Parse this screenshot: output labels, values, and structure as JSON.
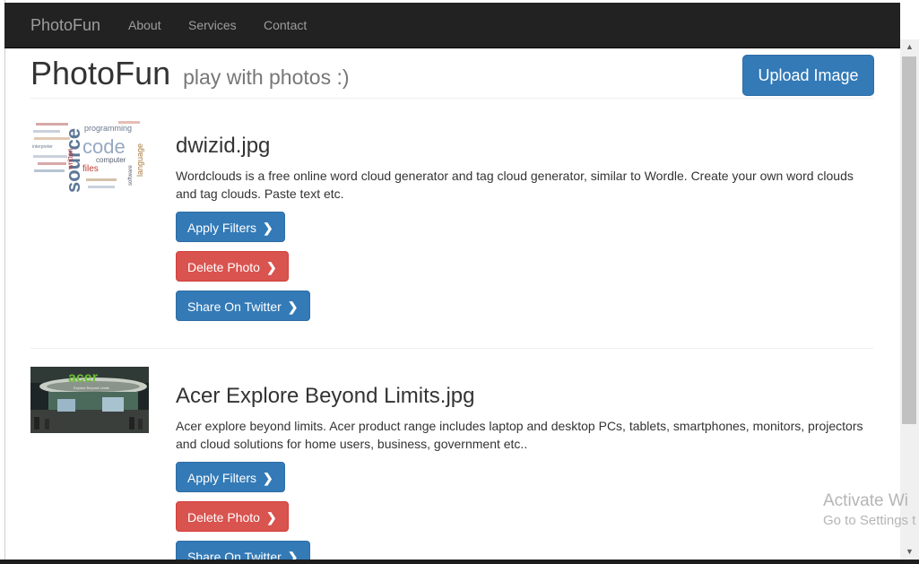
{
  "navbar": {
    "brand": "PhotoFun",
    "links": [
      "About",
      "Services",
      "Contact"
    ]
  },
  "header": {
    "title": "PhotoFun",
    "subtitle": "play with photos :)",
    "upload_label": "Upload Image"
  },
  "photos": [
    {
      "name": "dwizid.jpg",
      "description": "Wordclouds is a free online word cloud generator and tag cloud generator, similar to Wordle. Create your own word clouds and tag clouds. Paste text etc.",
      "thumbnail_words": [
        "programming",
        "source",
        "code",
        "written",
        "computer",
        "files",
        "language",
        "software",
        "interpreter"
      ],
      "buttons": {
        "apply": "Apply Filters",
        "delete": "Delete Photo",
        "share": "Share On Twitter"
      }
    },
    {
      "name": "Acer Explore Beyond Limits.jpg",
      "description": "Acer explore beyond limits. Acer product range includes laptop and desktop PCs, tablets, smartphones, monitors, projectors and cloud solutions for home users, business, government etc..",
      "thumbnail_words": [
        "acer",
        "Explore Beyond Limits"
      ],
      "buttons": {
        "apply": "Apply Filters",
        "delete": "Delete Photo",
        "share": "Share On Twitter"
      }
    }
  ],
  "watermark": {
    "line1": "Activate Wi",
    "line2": "Go to Settings t"
  },
  "scrollbar": {
    "up": "▲",
    "down": "▼"
  },
  "colors": {
    "navbar_bg": "#222222",
    "primary": "#337ab7",
    "danger": "#d9534f"
  }
}
